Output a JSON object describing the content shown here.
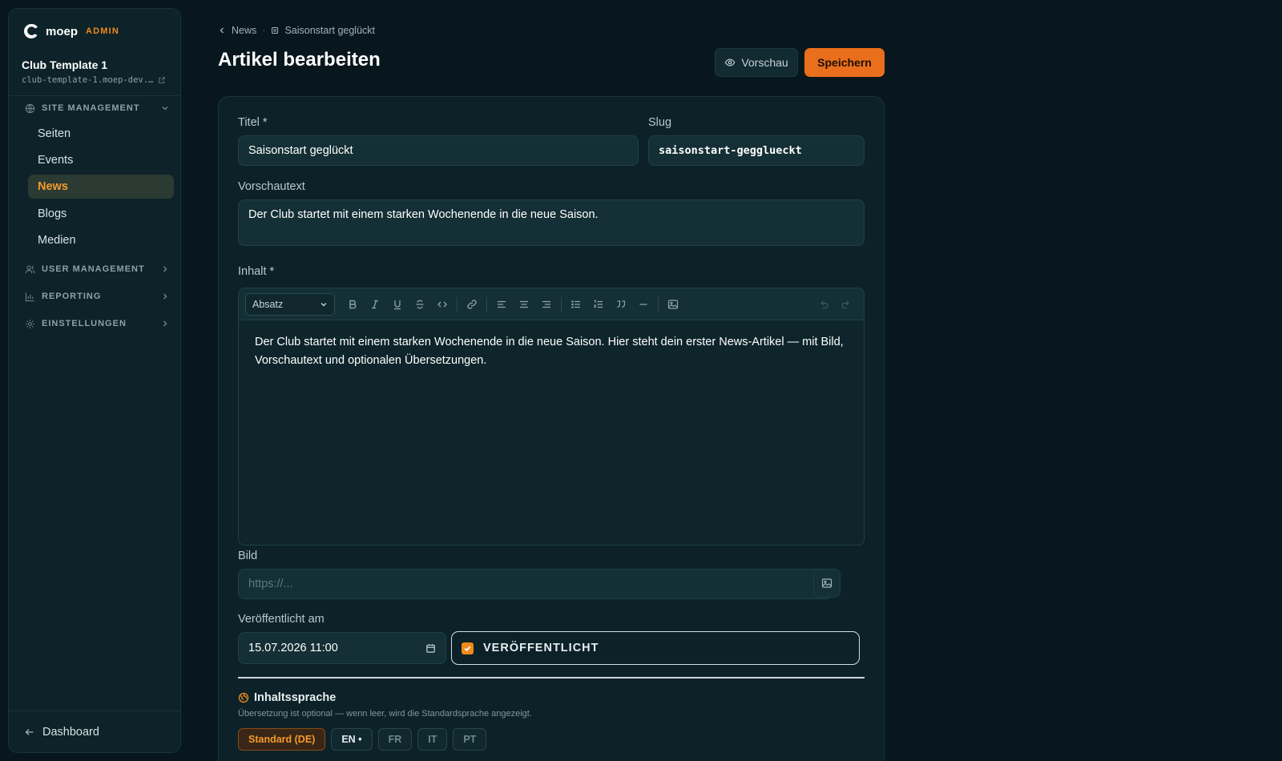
{
  "brand": {
    "name": "moep",
    "badge": "ADMIN"
  },
  "site": {
    "title": "Club Template 1",
    "domain": "club-template-1.moep-dev.…"
  },
  "sidebar": {
    "sections": [
      {
        "label": "SITE MANAGEMENT",
        "icon": "globe-icon",
        "expanded": true
      },
      {
        "label": "USER MANAGEMENT",
        "icon": "users-icon",
        "expanded": false
      },
      {
        "label": "REPORTING",
        "icon": "bar-chart-icon",
        "expanded": false
      },
      {
        "label": "EINSTELLUNGEN",
        "icon": "gear-icon",
        "expanded": false
      }
    ],
    "items": [
      {
        "label": "Seiten",
        "active": false
      },
      {
        "label": "Events",
        "active": false
      },
      {
        "label": "News",
        "active": true
      },
      {
        "label": "Blogs",
        "active": false
      },
      {
        "label": "Medien",
        "active": false
      }
    ],
    "footer_label": "Dashboard"
  },
  "breadcrumb": {
    "parent": "News",
    "current": "Saisonstart geglückt"
  },
  "page": {
    "title": "Artikel bearbeiten"
  },
  "actions": {
    "preview_label": "Vorschau",
    "save_label": "Speichern"
  },
  "form": {
    "title_label": "Titel *",
    "title_value": "Saisonstart geglückt",
    "slug_label": "Slug",
    "slug_value": "saisonstart-gegglueckt",
    "excerpt_label": "Vorschautext",
    "excerpt_value": "Der Club startet mit einem starken Wochenende in die neue Saison.",
    "content_label": "Inhalt *",
    "block_format": "Absatz",
    "content_value": "Der Club startet mit einem starken Wochenende in die neue Saison. Hier steht dein erster News-Artikel — mit Bild, Vorschautext und optionalen Übersetzungen.",
    "image_label": "Bild",
    "image_placeholder": "https://...",
    "published_at_label": "Veröffentlicht am",
    "published_at_value": "15.07.2026 11:00",
    "published_label": "VERÖFFENTLICHT",
    "published_checked": true
  },
  "language": {
    "title": "Inhaltssprache",
    "hint": "Übersetzung ist optional — wenn leer, wird die Standardsprache angezeigt.",
    "tabs": [
      "Standard (DE)",
      "EN •",
      "FR",
      "IT",
      "PT"
    ],
    "active_index": 0
  },
  "colors": {
    "accent": "#ea6f1c",
    "active_text": "#f59a2a",
    "background": "#07171d",
    "panel": "#0d2329"
  }
}
